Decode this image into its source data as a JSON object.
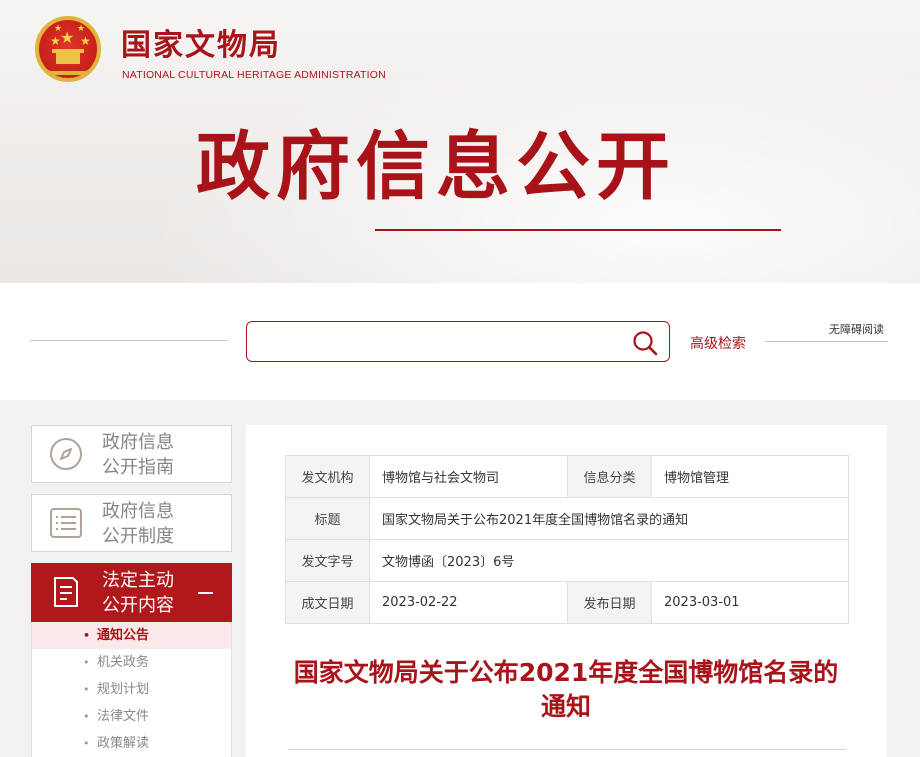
{
  "header": {
    "site_title": "国家文物局",
    "site_subtitle": "NATIONAL  CULTURAL HERITAGE ADMINISTRATION",
    "banner_title": "政府信息公开"
  },
  "search": {
    "placeholder": "",
    "advanced_label": "高级检索",
    "accessible_label": "无障碍阅读"
  },
  "sidebar": {
    "cards": [
      {
        "label": "政府信息公开指南",
        "line1": "政府信息",
        "line2": "公开指南",
        "icon": "compass-icon"
      },
      {
        "label": "政府信息公开制度",
        "line1": "政府信息",
        "line2": "公开制度",
        "icon": "list-icon"
      },
      {
        "label": "法定主动公开内容",
        "line1": "法定主动",
        "line2": "公开内容",
        "icon": "document-icon"
      }
    ],
    "sub_items": [
      "通知公告",
      "机关政务",
      "规划计划",
      "法律文件",
      "政策解读"
    ]
  },
  "meta": {
    "issuer_label": "发文机构",
    "issuer": "博物馆与社会文物司",
    "category_label": "信息分类",
    "category": "博物馆管理",
    "title_label": "标题",
    "title": "国家文物局关于公布2021年度全国博物馆名录的通知",
    "doc_no_label": "发文字号",
    "doc_no": "文物博函〔2023〕6号",
    "created_label": "成文日期",
    "created": "2023-02-22",
    "published_label": "发布日期",
    "published": "2023-03-01"
  },
  "document": {
    "title_line1": "国家文物局关于公布2021年度全国博物馆名录的",
    "title_line2": "通知"
  },
  "colors": {
    "brand_red": "#a8141a",
    "active_red": "#b1181c",
    "emblem_gold": "#e2b33c"
  }
}
